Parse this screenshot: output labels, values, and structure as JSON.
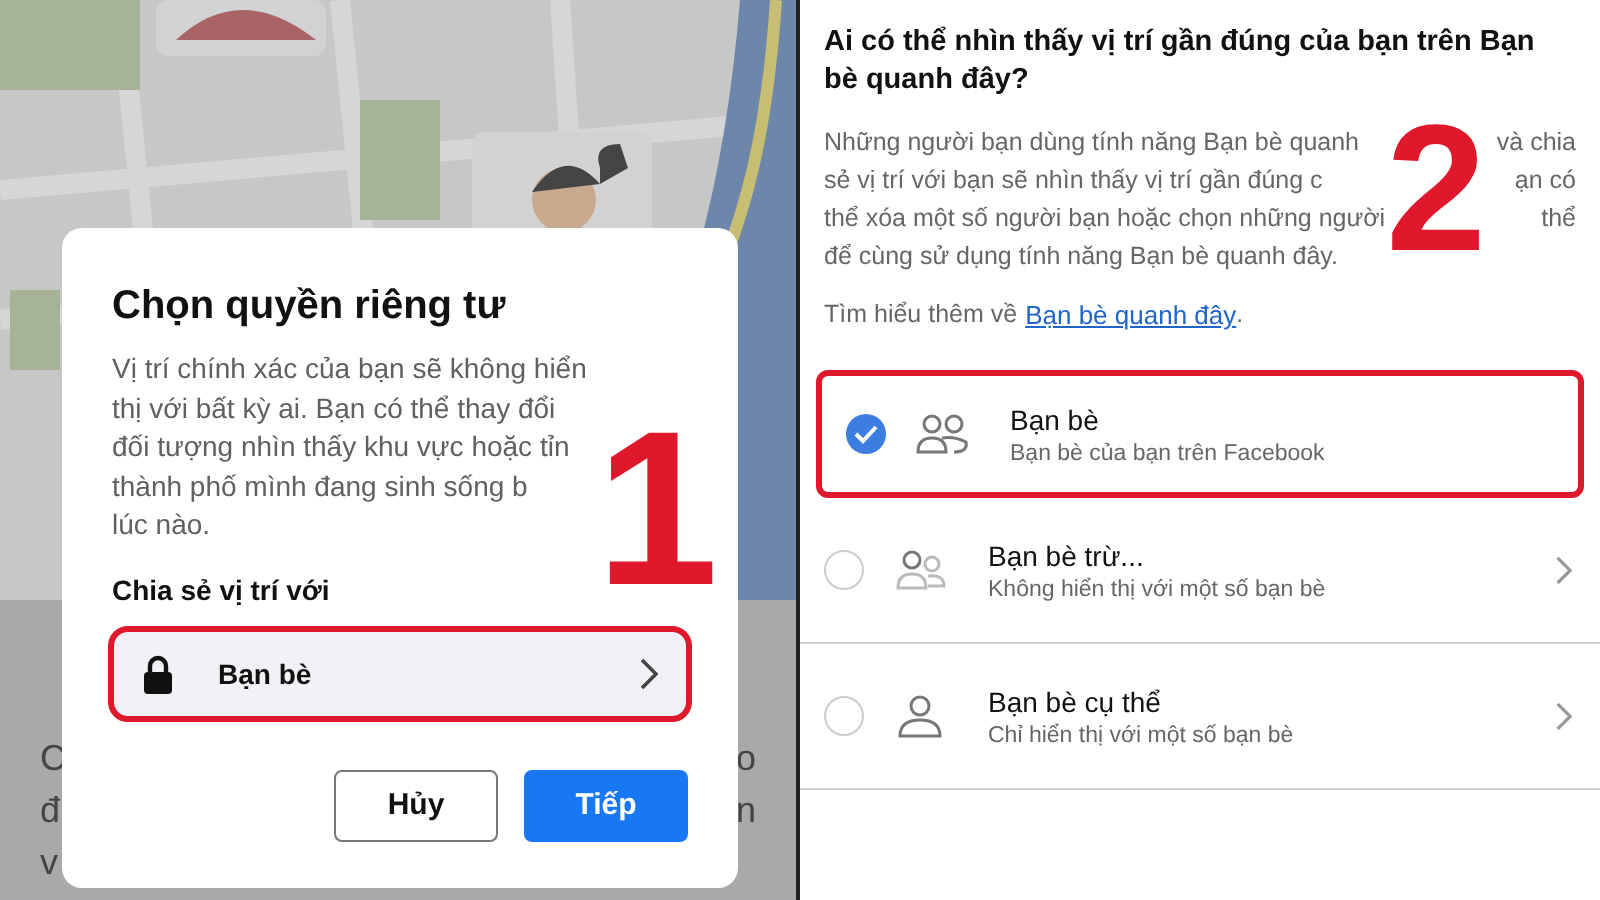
{
  "left_panel": {
    "sheet": {
      "left_fragments": [
        "C",
        "đ",
        "v"
      ],
      "right_fragments": [
        "o",
        "n"
      ]
    },
    "dialog": {
      "title": "Chọn quyền riêng tư",
      "lines": [
        "Vị trí chính xác của bạn sẽ không hiển",
        "thị với bất kỳ ai. Bạn có thể thay đổi",
        "đối tượng nhìn thấy khu vực hoặc tỉn",
        "thành phố mình đang sinh sống b",
        "lúc nào."
      ],
      "share_label": "Chia sẻ vị trí với",
      "audience": {
        "label": "Bạn bè",
        "highlighted": true
      },
      "buttons": [
        {
          "label": "Hủy",
          "kind": "secondary"
        },
        {
          "label": "Tiếp",
          "kind": "primary"
        }
      ]
    },
    "step": "1"
  },
  "right_panel": {
    "question": "Ai có thể nhìn thấy vị trí gần đúng của bạn trên Bạn bè quanh đây?",
    "lines": [
      {
        "left": "Những người bạn dùng tính năng Bạn bè quanh",
        "right": "và chia"
      },
      {
        "left": "sẻ vị trí với bạn sẽ nhìn thấy vị trí gần đúng c",
        "right": "ạn có"
      },
      {
        "left": "thể xóa một số người bạn hoặc chọn những người",
        "right": "thể"
      },
      {
        "left": "để cùng sử dụng tính năng Bạn bè quanh đây."
      }
    ],
    "learn_more": {
      "text": "Tìm hiểu thêm về",
      "link": "Bạn bè quanh đây",
      "end": "."
    },
    "options": [
      {
        "title": "Bạn bè",
        "subtitle": "Bạn bè của bạn trên Facebook",
        "selected": true,
        "kind": "friends",
        "chevron": false,
        "highlighted": true
      },
      {
        "title": "Bạn bè trừ...",
        "subtitle": "Không hiển thị với một số bạn bè",
        "selected": false,
        "kind": "friends-except",
        "chevron": true,
        "highlighted": false
      },
      {
        "title": "Bạn bè cụ thể",
        "subtitle": "Chỉ hiển thị với một số bạn bè",
        "selected": false,
        "kind": "person",
        "chevron": true,
        "highlighted": false
      }
    ],
    "step": "2"
  }
}
